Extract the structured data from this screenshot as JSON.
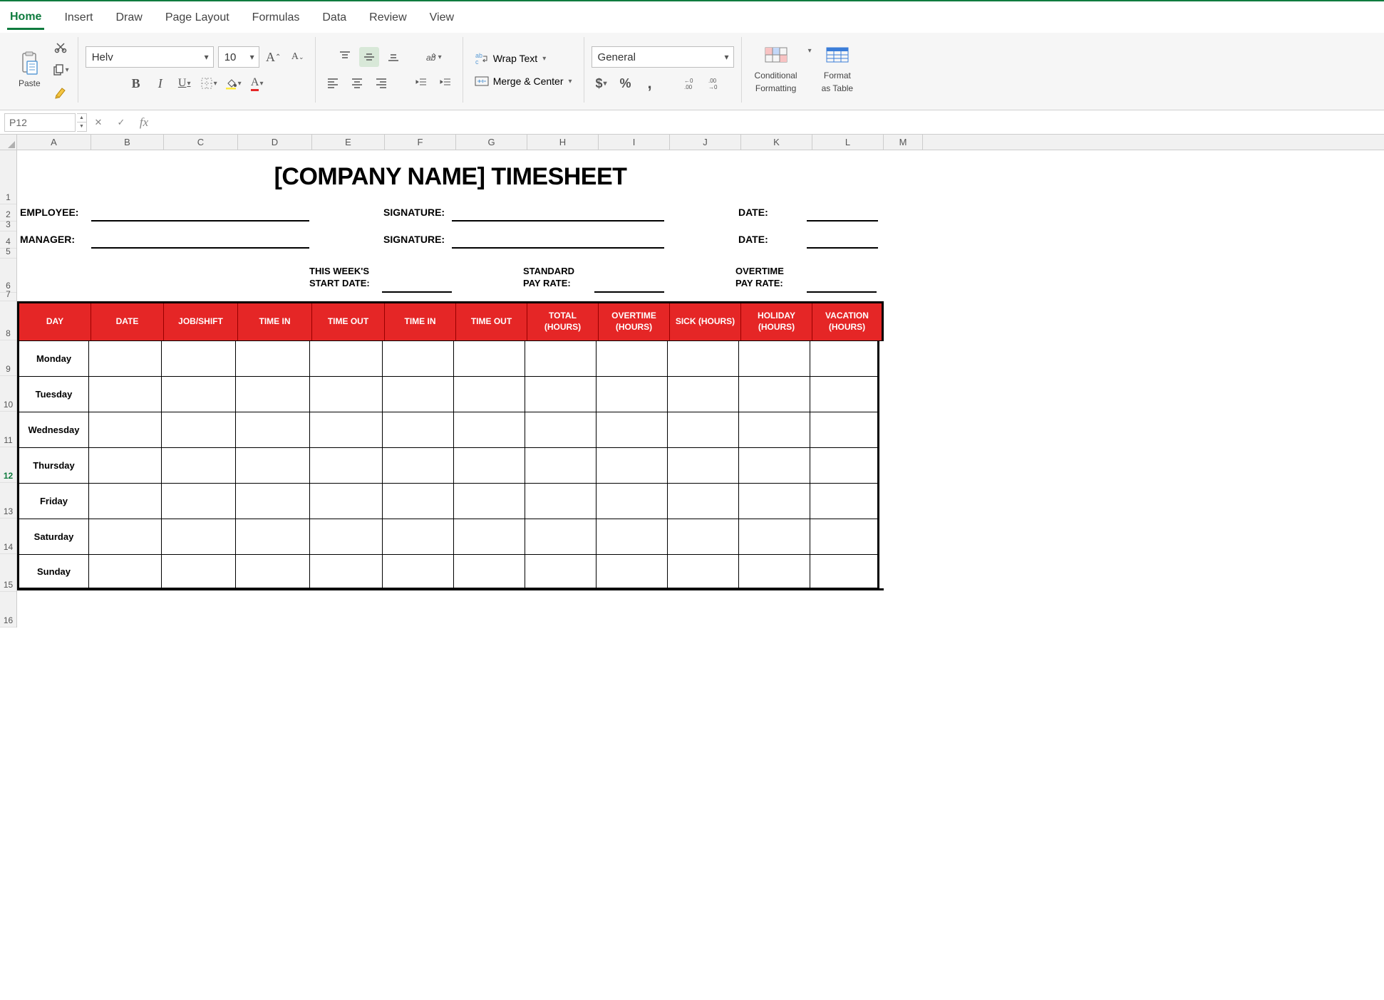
{
  "tabs": [
    "Home",
    "Insert",
    "Draw",
    "Page Layout",
    "Formulas",
    "Data",
    "Review",
    "View"
  ],
  "active_tab": "Home",
  "ribbon": {
    "paste_label": "Paste",
    "font_name": "Helv",
    "font_size": "10",
    "wrap_text": "Wrap Text",
    "merge_center": "Merge & Center",
    "number_format": "General",
    "cond_fmt_l1": "Conditional",
    "cond_fmt_l2": "Formatting",
    "fmt_tbl_l1": "Format",
    "fmt_tbl_l2": "as Table"
  },
  "formula_bar": {
    "name_box": "P12",
    "formula": ""
  },
  "columns": [
    "A",
    "B",
    "C",
    "D",
    "E",
    "F",
    "G",
    "H",
    "I",
    "J",
    "K",
    "L",
    "M"
  ],
  "rows": [
    "1",
    "2",
    "3",
    "4",
    "5",
    "6",
    "7",
    "8",
    "9",
    "10",
    "11",
    "12",
    "13",
    "14",
    "15",
    "16"
  ],
  "sheet": {
    "title": "[COMPANY NAME] TIMESHEET",
    "employee_lbl": "EMPLOYEE:",
    "manager_lbl": "MANAGER:",
    "signature_lbl": "SIGNATURE:",
    "date_lbl": "DATE:",
    "week_start_l1": "THIS WEEK'S",
    "week_start_l2": "START DATE:",
    "std_rate_l1": "STANDARD",
    "std_rate_l2": "PAY RATE:",
    "ot_rate_l1": "OVERTIME",
    "ot_rate_l2": "PAY RATE:",
    "headers": [
      "DAY",
      "DATE",
      "JOB/SHIFT",
      "TIME IN",
      "TIME OUT",
      "TIME IN",
      "TIME OUT",
      "TOTAL (HOURS)",
      "OVERTIME (HOURS)",
      "SICK (HOURS)",
      "HOLIDAY (HOURS)",
      "VACATION (HOURS)"
    ],
    "days": [
      "Monday",
      "Tuesday",
      "Wednesday",
      "Thursday",
      "Friday",
      "Saturday",
      "Sunday"
    ]
  }
}
